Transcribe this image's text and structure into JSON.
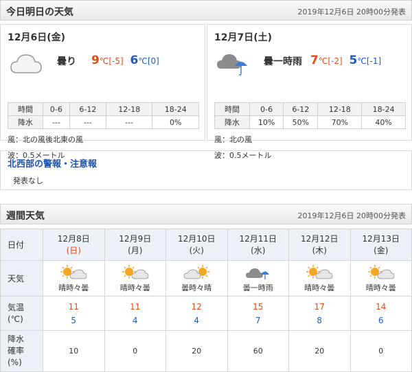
{
  "today_header": {
    "title": "今日明日の天気",
    "issued": "2019年12月6日 20時00分発表"
  },
  "today": {
    "date": "12月6日(金)",
    "icon": "cloud-icon",
    "telop": "曇り",
    "high": "9",
    "high_unit": "℃",
    "high_diff": "[-5]",
    "low": "6",
    "low_unit": "℃",
    "low_diff": "[0]",
    "rain_table": {
      "label_time": "時間",
      "label_rain": "降水",
      "periods": [
        "0-6",
        "6-12",
        "12-18",
        "18-24"
      ],
      "values": [
        "---",
        "---",
        "---",
        "0%"
      ]
    },
    "wind": "風：北の風後北東の風",
    "wave": "波：0.5メートル"
  },
  "tomorrow": {
    "date": "12月7日(土)",
    "icon": "cloud-umbrella-icon",
    "telop": "曇一時雨",
    "high": "7",
    "high_unit": "℃",
    "high_diff": "[-2]",
    "low": "5",
    "low_unit": "℃",
    "low_diff": "[-1]",
    "rain_table": {
      "label_time": "時間",
      "label_rain": "降水",
      "periods": [
        "0-6",
        "6-12",
        "12-18",
        "18-24"
      ],
      "values": [
        "10%",
        "50%",
        "70%",
        "40%"
      ]
    },
    "wind": "風：北の風",
    "wave": "波：0.5メートル"
  },
  "warnings": {
    "title": "北西部の警報・注意報",
    "text": "発表なし"
  },
  "weekly_header": {
    "title": "週間天気",
    "issued": "2019年12月6日 20時00分発表"
  },
  "weekly": {
    "label_date": "日付",
    "label_weather": "天気",
    "label_temp": [
      "気温",
      "(℃)"
    ],
    "label_precip": [
      "降水",
      "確率",
      "(%)"
    ],
    "days": [
      {
        "date": "12月8日",
        "dow": "(日)",
        "icon": "sun-cloud-icon",
        "weather": "晴時々曇",
        "high": "11",
        "low": "5",
        "precip": "10"
      },
      {
        "date": "12月9日",
        "dow": "(月)",
        "icon": "sun-cloud-icon",
        "weather": "晴時々曇",
        "high": "11",
        "low": "4",
        "precip": "0"
      },
      {
        "date": "12月10日",
        "dow": "(火)",
        "icon": "cloud-sun-icon",
        "weather": "曇時々晴",
        "high": "12",
        "low": "4",
        "precip": "20"
      },
      {
        "date": "12月11日",
        "dow": "(水)",
        "icon": "cloud-umbrella-icon",
        "weather": "曇一時雨",
        "high": "15",
        "low": "7",
        "precip": "60"
      },
      {
        "date": "12月12日",
        "dow": "(木)",
        "icon": "sun-cloud-icon",
        "weather": "晴時々曇",
        "high": "17",
        "low": "8",
        "precip": "20"
      },
      {
        "date": "12月13日",
        "dow": "(金)",
        "icon": "sun-cloud-icon",
        "weather": "晴時々曇",
        "high": "14",
        "low": "6",
        "precip": "0"
      }
    ]
  },
  "colors": {
    "high": "#e64a19",
    "low": "#1f5bc4",
    "link": "#1a55b5",
    "header_bg": "#eeeeee",
    "label_bg": "#ecf1f7"
  }
}
